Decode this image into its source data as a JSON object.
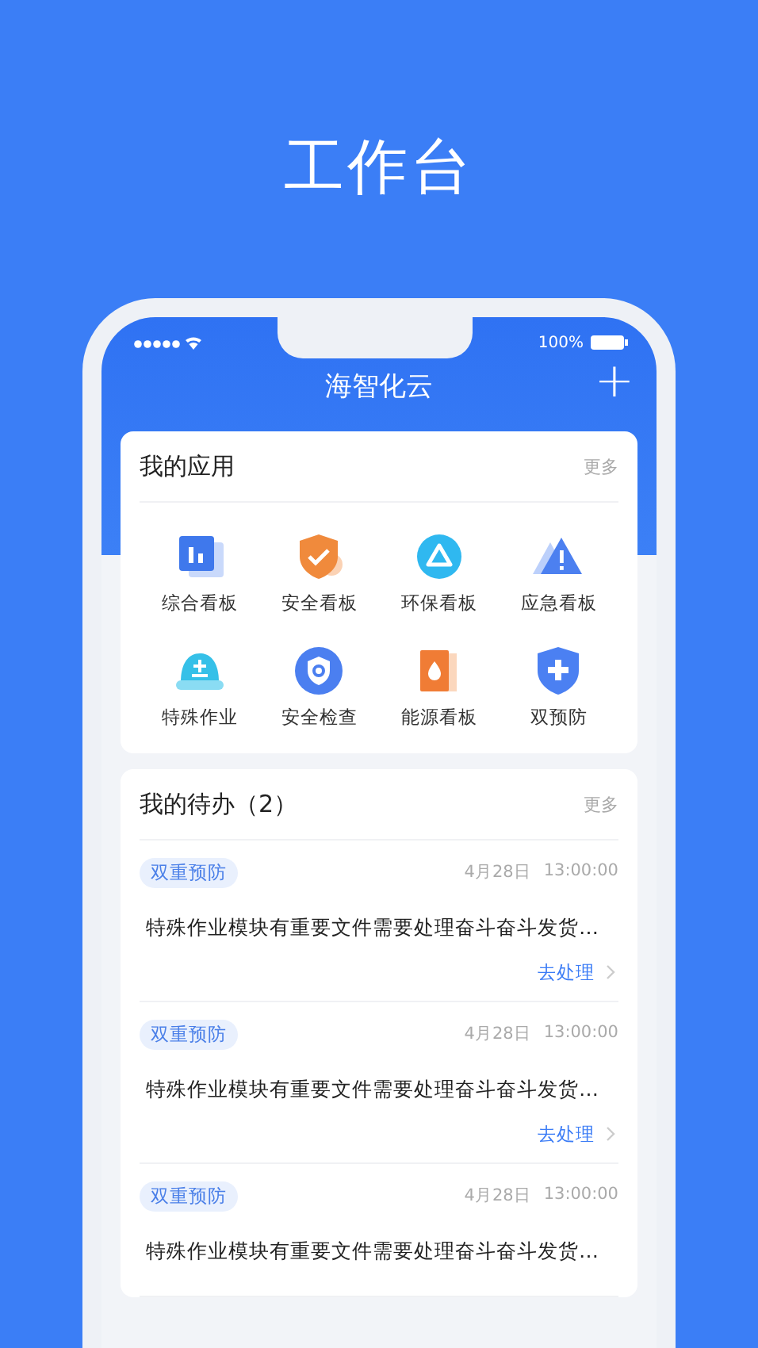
{
  "headline": "工作台",
  "status_bar": {
    "battery_text": "100%"
  },
  "nav": {
    "title": "海智化云",
    "add_button": "+"
  },
  "apps": {
    "title": "我的应用",
    "more": "更多",
    "items": [
      {
        "label": "综合看板"
      },
      {
        "label": "安全看板"
      },
      {
        "label": "环保看板"
      },
      {
        "label": "应急看板"
      },
      {
        "label": "特殊作业"
      },
      {
        "label": "安全检查"
      },
      {
        "label": "能源看板"
      },
      {
        "label": "双预防"
      }
    ]
  },
  "todos": {
    "title": "我的待办（2）",
    "more": "更多",
    "items": [
      {
        "tag": "双重预防",
        "date": "4月28日",
        "time": "13:00:00",
        "text": "特殊作业模块有重要文件需要处理奋斗奋斗发货…",
        "action": "去处理"
      },
      {
        "tag": "双重预防",
        "date": "4月28日",
        "time": "13:00:00",
        "text": "特殊作业模块有重要文件需要处理奋斗奋斗发货…",
        "action": "去处理"
      },
      {
        "tag": "双重预防",
        "date": "4月28日",
        "time": "13:00:00",
        "text": "特殊作业模块有重要文件需要处理奋斗奋斗发货…"
      }
    ]
  }
}
